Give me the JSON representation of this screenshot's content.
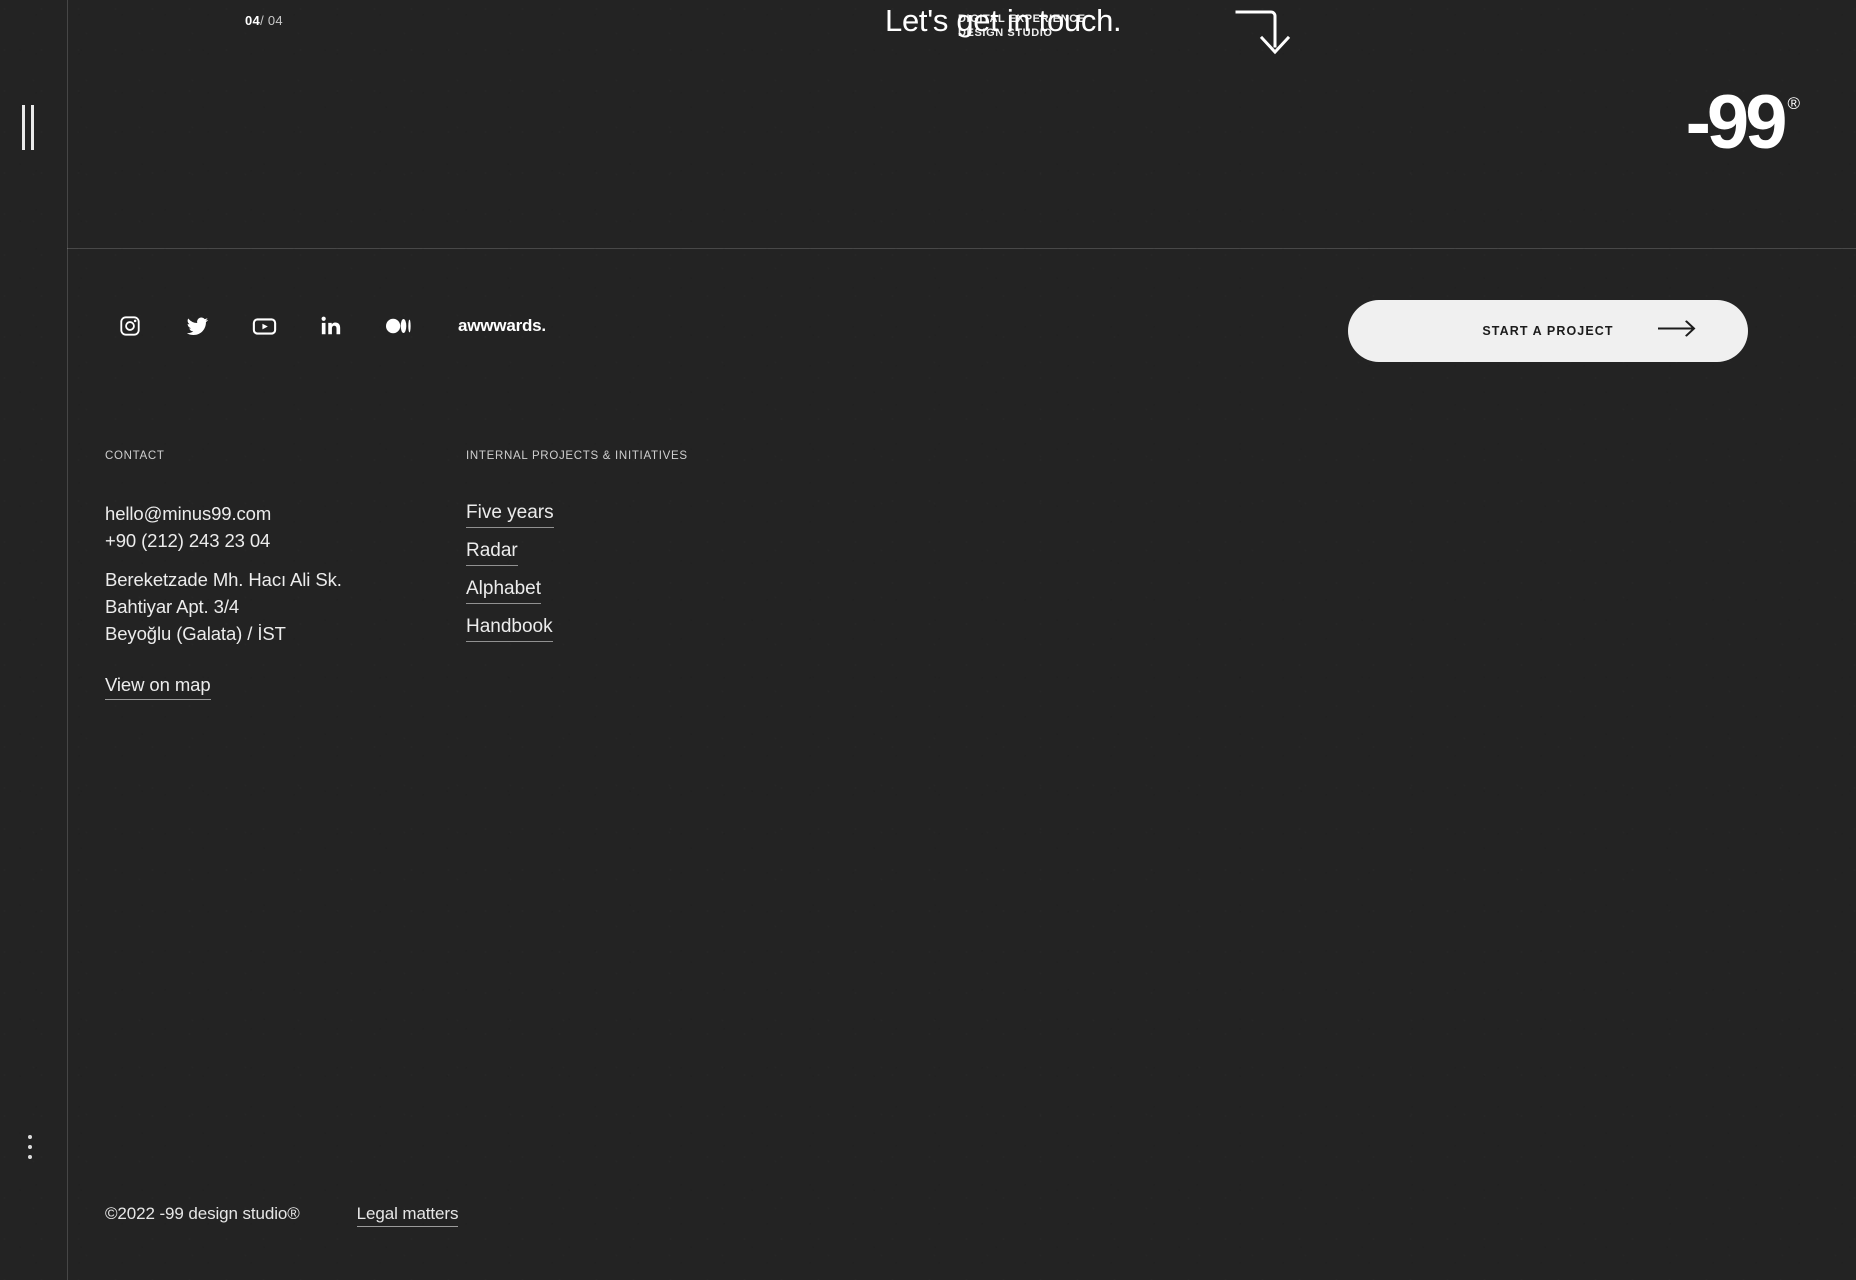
{
  "page": {
    "background_color": "#232323",
    "text_color": "#f2f2f2"
  },
  "rail": {
    "pause_icon": "pause-icon",
    "kebab_icon": "kebab-menu-icon"
  },
  "hero": {
    "counter_current": "04",
    "counter_separator": "/ ",
    "counter_total": "04",
    "title": "Let's get in touch.",
    "studio_tagline": "DIGITAL EXPERIENCE\nDESIGN STUDIO",
    "arrow_icon": "corner-down-arrow-icon",
    "logo_mark": "-99",
    "logo_registered": "®"
  },
  "social": {
    "items": [
      {
        "name": "instagram-icon",
        "label": "Instagram"
      },
      {
        "name": "twitter-icon",
        "label": "Twitter"
      },
      {
        "name": "youtube-icon",
        "label": "YouTube"
      },
      {
        "name": "linkedin-icon",
        "label": "LinkedIn"
      },
      {
        "name": "medium-icon",
        "label": "Medium"
      }
    ],
    "awwwards_label": "awwwards."
  },
  "cta": {
    "label": "START A PROJECT",
    "arrow_icon": "arrow-right-icon",
    "background_color": "#f0f0f0",
    "text_color": "#1c1c1c"
  },
  "contact": {
    "heading": "CONTACT",
    "email": "hello@minus99.com",
    "phone": "+90 (212) 243 23 04",
    "address_line1": "Bereketzade Mh. Hacı Ali Sk.",
    "address_line2": "Bahtiyar Apt. 3/4",
    "address_line3": "Beyoğlu (Galata) / İST",
    "map_link": "View on map"
  },
  "projects": {
    "heading": "INTERNAL PROJECTS & INITIATIVES",
    "items": [
      {
        "label": "Five years"
      },
      {
        "label": "Radar"
      },
      {
        "label": "Alphabet"
      },
      {
        "label": "Handbook"
      }
    ]
  },
  "footer": {
    "copyright": "©2022 -99 design studio®",
    "legal_label": "Legal matters"
  }
}
